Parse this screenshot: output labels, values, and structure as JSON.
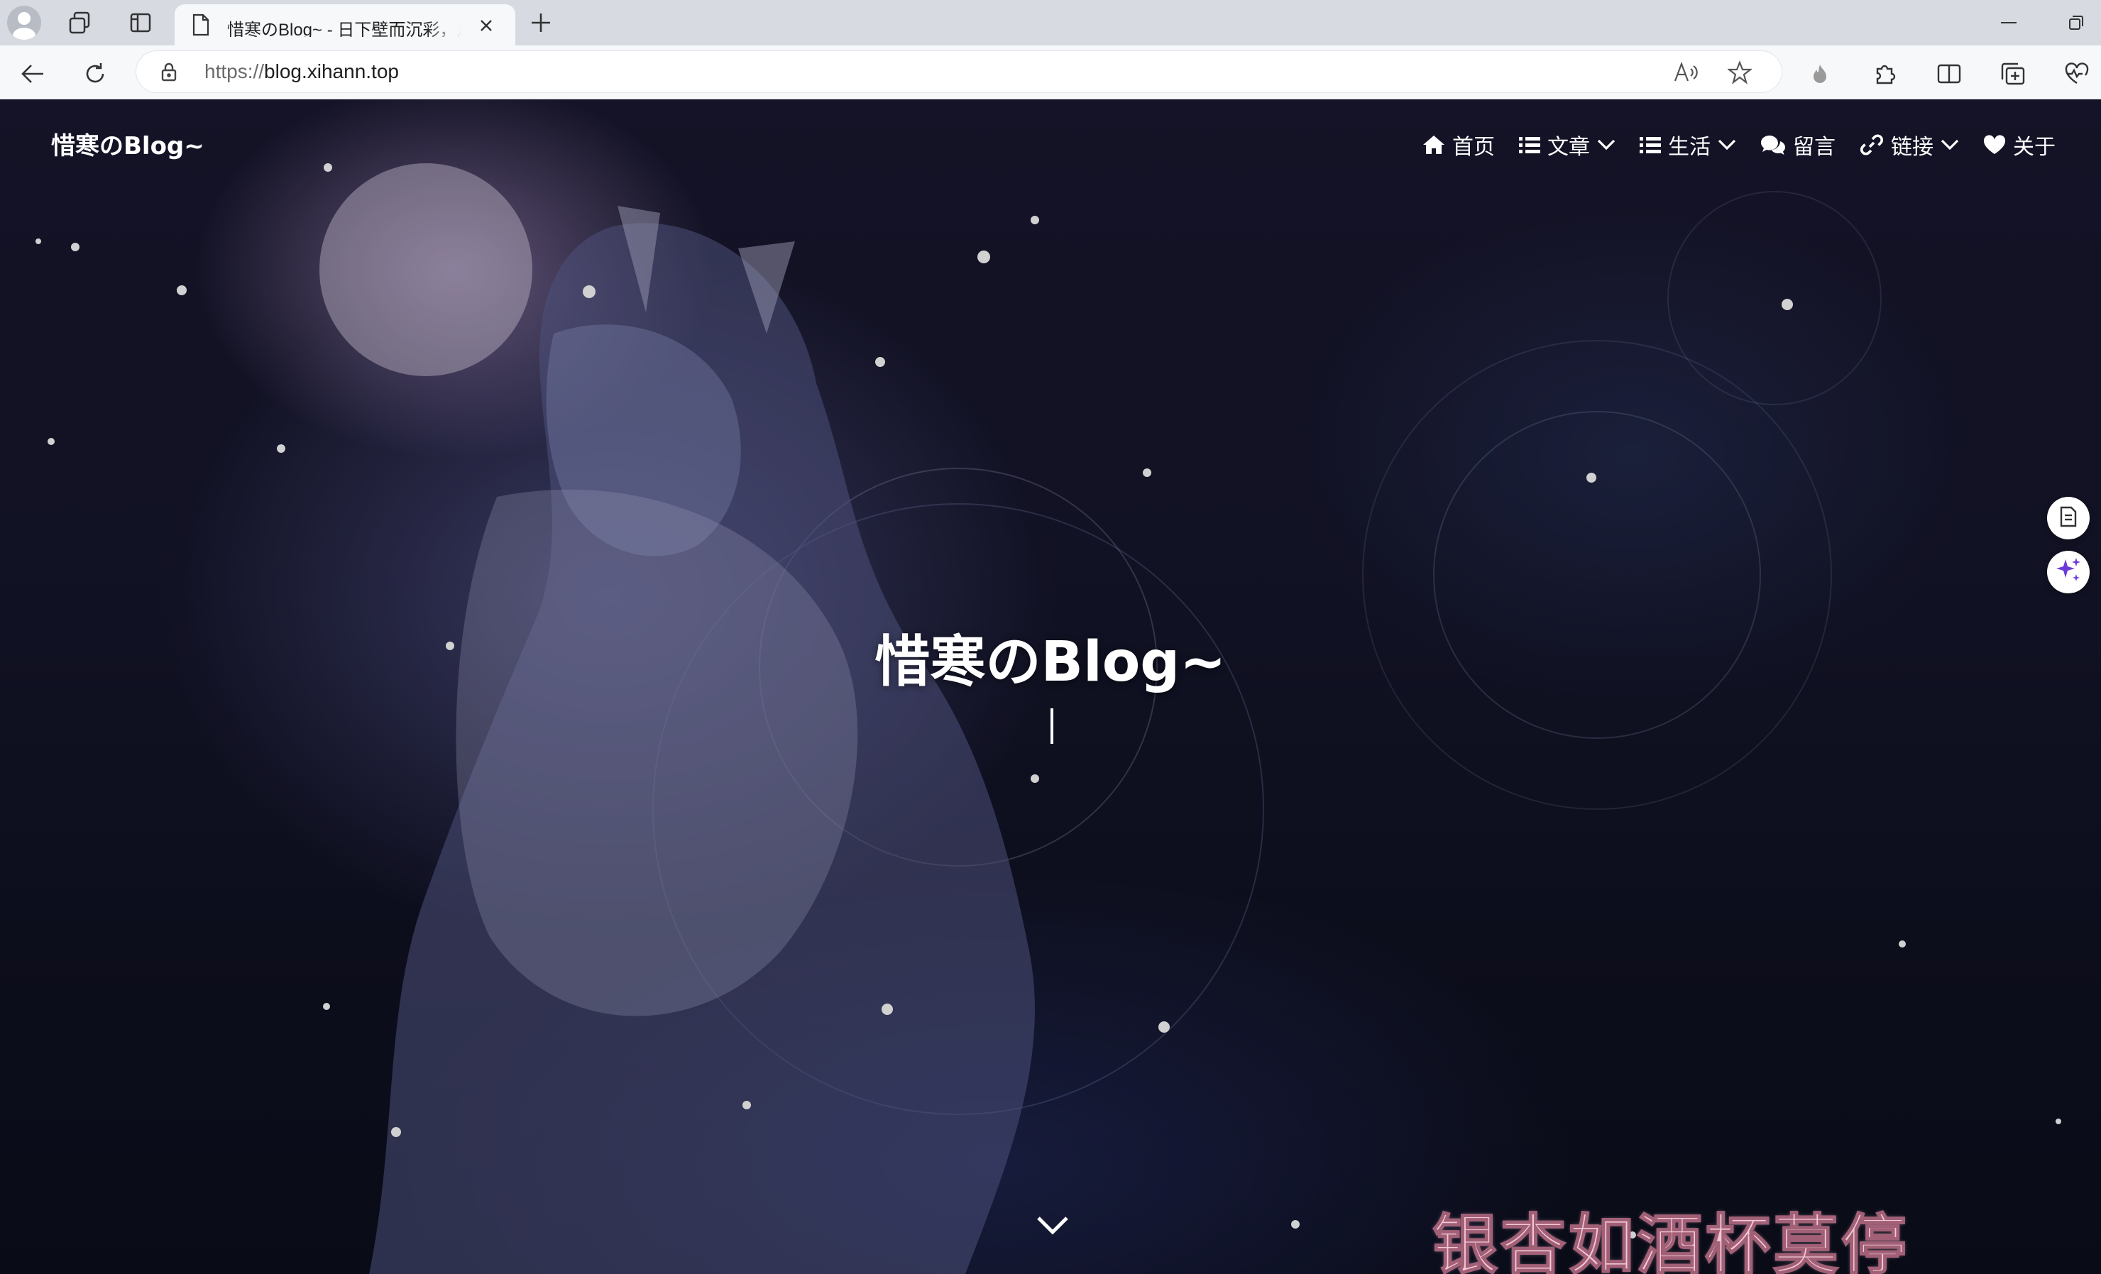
{
  "browser": {
    "tab": {
      "title": "惜寒のBlog~ - 日下壁而沉彩，月"
    },
    "address_bar": {
      "scheme": "https://",
      "host": "blog.xihann.top"
    }
  },
  "site": {
    "brand": "惜寒のBlog~",
    "nav": [
      {
        "label": "首页",
        "icon": "home-icon",
        "dropdown": false
      },
      {
        "label": "文章",
        "icon": "list-icon",
        "dropdown": true
      },
      {
        "label": "生活",
        "icon": "list-icon",
        "dropdown": true
      },
      {
        "label": "留言",
        "icon": "comments-icon",
        "dropdown": false
      },
      {
        "label": "链接",
        "icon": "link-icon",
        "dropdown": true
      },
      {
        "label": "关于",
        "icon": "heart-icon",
        "dropdown": false
      }
    ],
    "hero": {
      "title": "惜寒のBlog~"
    },
    "poem": "银杏如酒杯莫停"
  },
  "icons": {
    "tabbar": [
      "profile-avatar",
      "workspaces-icon",
      "vertical-tabs-icon",
      "page-icon",
      "close-icon",
      "plus-icon",
      "minimize-icon",
      "restore-icon"
    ],
    "toolbar": [
      "back-arrow-icon",
      "refresh-icon",
      "lock-icon",
      "read-aloud-icon",
      "star-icon",
      "flame-icon",
      "puzzle-icon",
      "split-screen-icon",
      "collections-icon",
      "performance-icon"
    ],
    "side": [
      "reading-view-icon",
      "copilot-sparkle-icon"
    ]
  },
  "colors": {
    "tabbar_bg": "#d7dbe1",
    "toolbar_bg": "#f7f8fa",
    "poem_pink": "#f3c8d6",
    "copilot_purple": "#6c3bd7"
  }
}
